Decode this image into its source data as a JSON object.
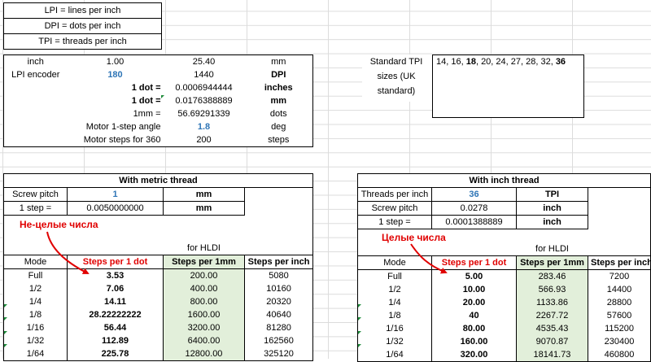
{
  "definitions": [
    "LPI = lines per inch",
    "DPI = dots per inch",
    "TPI = threads per inch"
  ],
  "params": [
    [
      "inch",
      "1.00",
      "25.40",
      "mm"
    ],
    [
      "LPI encoder",
      "180",
      "1440",
      "DPI"
    ],
    [
      "1 dot =",
      "0.0006944444",
      "inches"
    ],
    [
      "1 dot =",
      "0.0176388889",
      "mm"
    ],
    [
      "1mm =",
      "56.69291339",
      "dots"
    ],
    [
      "Motor 1-step angle",
      "1.8",
      "deg"
    ],
    [
      "Motor steps for 360",
      "200",
      "steps"
    ]
  ],
  "tpi": {
    "label": "Standard TPI sizes (UK standard)",
    "parts": [
      "14, 16, ",
      "18",
      ", 20, 24, 27, 28, 32, ",
      "36"
    ]
  },
  "metric": {
    "title": "With metric thread",
    "screw_label": "Screw pitch",
    "screw_val": "1",
    "screw_unit": "mm",
    "step_label": "1 step =",
    "step_val": "0.0050000000",
    "step_unit": "mm",
    "annotation": "Не-целые числа",
    "hldi": "for HLDI",
    "headers": [
      "Mode",
      "Steps per 1 dot",
      "Steps per 1mm",
      "Steps per inch"
    ],
    "rows": [
      [
        "Full",
        "3.53",
        "200.00",
        "5080"
      ],
      [
        "1/2",
        "7.06",
        "400.00",
        "10160"
      ],
      [
        "1/4",
        "14.11",
        "800.00",
        "20320"
      ],
      [
        "1/8",
        "28.22222222",
        "1600.00",
        "40640"
      ],
      [
        "1/16",
        "56.44",
        "3200.00",
        "81280"
      ],
      [
        "1/32",
        "112.89",
        "6400.00",
        "162560"
      ],
      [
        "1/64",
        "225.78",
        "12800.00",
        "325120"
      ]
    ]
  },
  "inch": {
    "title": "With inch thread",
    "tpi_label": "Threads per inch",
    "tpi_val": "36",
    "tpi_unit": "TPI",
    "screw_label": "Screw pitch",
    "screw_val": "0.0278",
    "screw_unit": "inch",
    "step_label": "1 step =",
    "step_val": "0.0001388889",
    "step_unit": "inch",
    "annotation": "Целые числа",
    "hldi": "for HLDI",
    "headers": [
      "Mode",
      "Steps per 1 dot",
      "Steps per 1mm",
      "Steps per inch"
    ],
    "rows": [
      [
        "Full",
        "5.00",
        "283.46",
        "7200"
      ],
      [
        "1/2",
        "10.00",
        "566.93",
        "14400"
      ],
      [
        "1/4",
        "20.00",
        "1133.86",
        "28800"
      ],
      [
        "1/8",
        "40",
        "2267.72",
        "57600"
      ],
      [
        "1/16",
        "80.00",
        "4535.43",
        "115200"
      ],
      [
        "1/32",
        "160.00",
        "9070.87",
        "230400"
      ],
      [
        "1/64",
        "320.00",
        "18141.73",
        "460800"
      ]
    ]
  }
}
